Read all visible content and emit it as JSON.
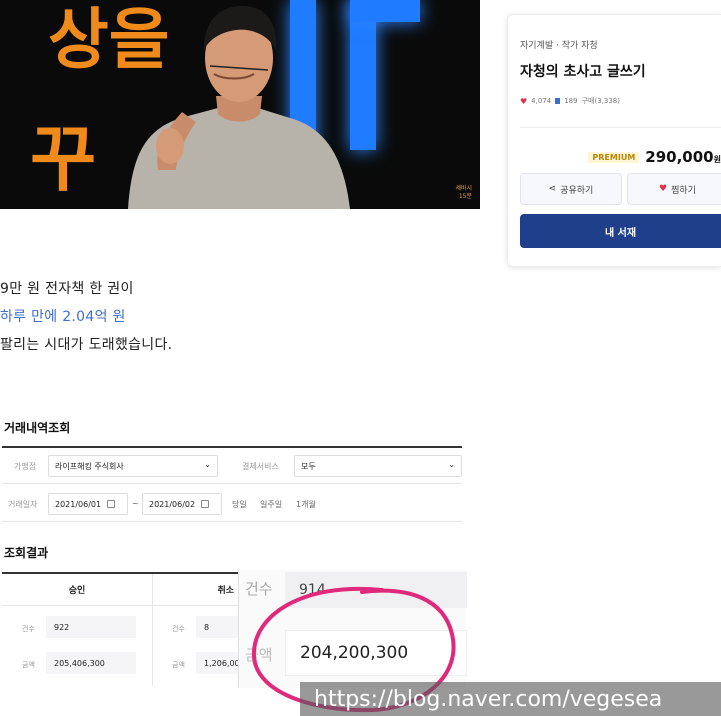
{
  "hero": {
    "sign_glyphs": [
      "상을",
      "꾸"
    ],
    "watermark_lines": [
      "세바시",
      "15분"
    ]
  },
  "product": {
    "category": "자기계발 · 작가 자청",
    "title": "자청의 초사고 글쓰기",
    "likes": "4,074",
    "bookmarks": "189",
    "purchases": "구매(3,338)",
    "premium_badge": "PREMIUM",
    "price": "290,000",
    "price_unit": "원",
    "share_label": "공유하기",
    "wish_label": "찜하기",
    "buy_label": "내 서재",
    "colors": {
      "buy": "#1f3f8a",
      "premium": "#b8860b",
      "heart": "#e0304a"
    }
  },
  "article": {
    "line1": "9만 원 전자책 한 권이",
    "line2": "하루 만에 2.04억 원",
    "line3": "팔리는 시대가 도래했습니다.",
    "highlight_color": "#3d6fd1"
  },
  "transactions": {
    "title": "거래내역조회",
    "merchant_label": "가맹점",
    "merchant_value": "라이프해킹 주식회사",
    "payment_label": "결제서비스",
    "payment_value": "모두",
    "date_label": "거래일자",
    "date_from": "2021/06/01",
    "date_sep": "~",
    "date_to": "2021/06/02",
    "quick_ranges": [
      "당일",
      "일주일",
      "1개월"
    ]
  },
  "results": {
    "title": "조회결과",
    "approve_header": "승인",
    "cancel_header": "취소",
    "count_label": "건수",
    "amount_label": "금액",
    "approve_count": "922",
    "approve_amount": "205,406,300",
    "cancel_count": "8",
    "cancel_amount": "1,206,00"
  },
  "zoom": {
    "count_label": "건수",
    "count_value": "914",
    "amount_label": "금액",
    "amount_value": "204,200,300",
    "circle_color": "#e0297a"
  },
  "watermark_url": "https://blog.naver.com/vegesea"
}
